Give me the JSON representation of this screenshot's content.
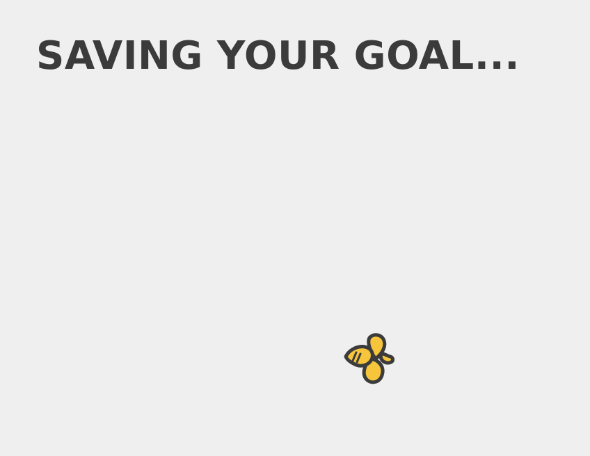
{
  "page": {
    "title": "SAVING YOUR GOAL...",
    "loader_icon": "bee-icon"
  },
  "colors": {
    "background": "#efefef",
    "text": "#3b3b3b",
    "bee_body": "#f6c53b",
    "bee_outline": "#3b3b3b"
  }
}
